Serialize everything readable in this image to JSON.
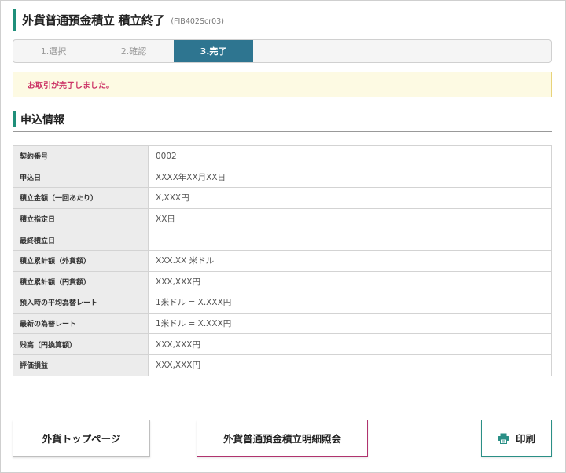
{
  "header": {
    "title": "外貨普通預金積立 積立終了",
    "screen_code": "(FIB402Scr03)"
  },
  "steps": [
    {
      "label": "1.選択",
      "active": false
    },
    {
      "label": "2.確認",
      "active": false
    },
    {
      "label": "3.完了",
      "active": true
    }
  ],
  "notice": {
    "message": "お取引が完了しました。"
  },
  "section": {
    "title": "申込情報"
  },
  "info_rows": [
    {
      "label": "契約番号",
      "value": "0002"
    },
    {
      "label": "申込日",
      "value": "XXXX年XX月XX日"
    },
    {
      "label": "積立金額（一回あたり）",
      "value": "X,XXX円"
    },
    {
      "label": "積立指定日",
      "value": "XX日"
    },
    {
      "label": "最終積立日",
      "value": ""
    },
    {
      "label": "積立累計額（外貨額）",
      "value": "XXX.XX 米ドル"
    },
    {
      "label": "積立累計額（円貨額）",
      "value": "XXX,XXX円"
    },
    {
      "label": "預入時の平均為替レート",
      "value": "1米ドル = X.XXX円"
    },
    {
      "label": "最新の為替レート",
      "value": "1米ドル = X.XXX円"
    },
    {
      "label": "残高（円換算額）",
      "value": "XXX,XXX円"
    },
    {
      "label": "評価損益",
      "value": "XXX,XXX円"
    }
  ],
  "buttons": {
    "top_page": "外貨トップページ",
    "detail_inquiry": "外貨普通預金積立明細照会",
    "print": "印刷"
  },
  "colors": {
    "accent_green": "#1f8f7a",
    "active_step": "#2e7590",
    "notice_text": "#cc3366",
    "detail_border": "#b0336e",
    "print_icon": "#2a8f86"
  },
  "icons": {
    "print": "printer-icon"
  }
}
